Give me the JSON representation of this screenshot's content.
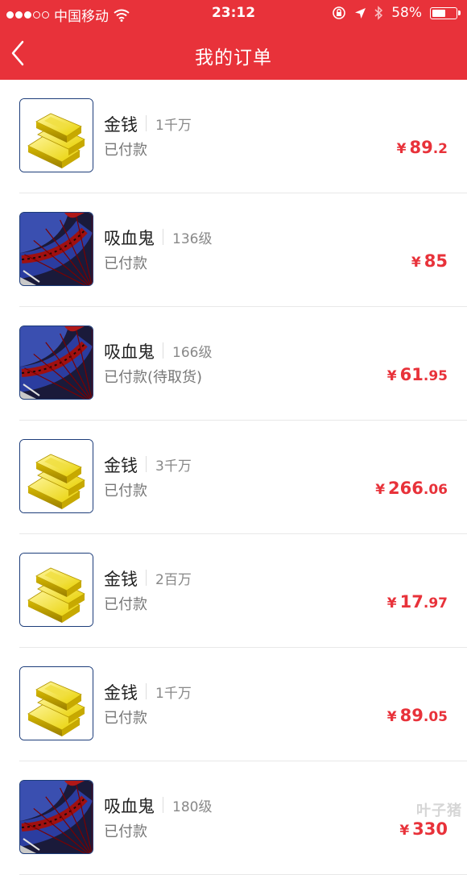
{
  "status_bar": {
    "carrier": "中国移动",
    "time": "23:12",
    "battery": "58%",
    "battery_level": 0.58
  },
  "header": {
    "title": "我的订单"
  },
  "orders": [
    {
      "name": "金钱",
      "detail": "1千万",
      "status": "已付款",
      "currency": "¥",
      "price_int": "89",
      "price_dec": ".2",
      "icon": "gold-bars-icon"
    },
    {
      "name": "吸血鬼",
      "detail": "136级",
      "status": "已付款",
      "currency": "¥",
      "price_int": "85",
      "price_dec": "",
      "icon": "vampire-avatar-icon"
    },
    {
      "name": "吸血鬼",
      "detail": "166级",
      "status": "已付款(待取货)",
      "currency": "¥",
      "price_int": "61",
      "price_dec": ".95",
      "icon": "vampire-avatar-icon"
    },
    {
      "name": "金钱",
      "detail": "3千万",
      "status": "已付款",
      "currency": "¥",
      "price_int": "266",
      "price_dec": ".06",
      "icon": "gold-bars-icon"
    },
    {
      "name": "金钱",
      "detail": "2百万",
      "status": "已付款",
      "currency": "¥",
      "price_int": "17",
      "price_dec": ".97",
      "icon": "gold-bars-icon"
    },
    {
      "name": "金钱",
      "detail": "1千万",
      "status": "已付款",
      "currency": "¥",
      "price_int": "89",
      "price_dec": ".05",
      "icon": "gold-bars-icon"
    },
    {
      "name": "吸血鬼",
      "detail": "180级",
      "status": "已付款",
      "currency": "¥",
      "price_int": "330",
      "price_dec": "",
      "icon": "vampire-avatar-icon"
    }
  ],
  "watermark": "叶子猪",
  "colors": {
    "header": "#e8323a",
    "price": "#e8323a",
    "thumb_border": "#1d3d7a"
  }
}
